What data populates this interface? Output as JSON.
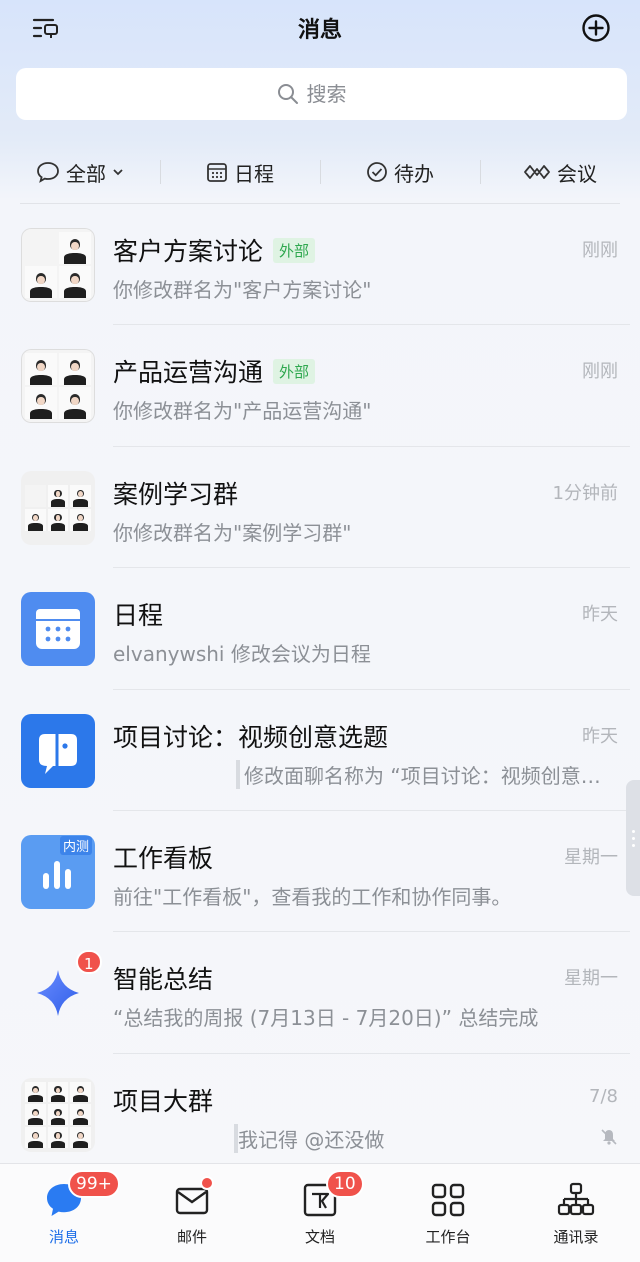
{
  "header": {
    "title": "消息"
  },
  "search": {
    "placeholder": "搜索"
  },
  "filters": [
    {
      "label": "全部"
    },
    {
      "label": "日程"
    },
    {
      "label": "待办"
    },
    {
      "label": "会议"
    }
  ],
  "conversations": [
    {
      "name": "客户方案讨论",
      "tag": "外部",
      "time": "刚刚",
      "preview": "你修改群名为\"客户方案讨论\""
    },
    {
      "name": "产品运营沟通",
      "tag": "外部",
      "time": "刚刚",
      "preview": "你修改群名为\"产品运营沟通\""
    },
    {
      "name": "案例学习群",
      "time": "1分钟前",
      "preview": "你修改群名为\"案例学习群\""
    },
    {
      "name": "日程",
      "time": "昨天",
      "preview": "elvanywshi 修改会议为日程"
    },
    {
      "name": "项目讨论：视频创意选题",
      "time": "昨天",
      "preview": "修改面聊名称为 “项目讨论：视频创意选题”"
    },
    {
      "name": "工作看板",
      "time": "星期一",
      "preview": "前往\"工作看板\"，查看我的工作和协作同事。",
      "avatar_tag": "内测"
    },
    {
      "name": "智能总结",
      "time": "星期一",
      "preview": "“总结我的周报 (7月13日 - 7月20日)” 总结完成",
      "badge": "1"
    },
    {
      "name": "项目大群",
      "time": "7/8",
      "preview": "我记得 @还没做"
    }
  ],
  "tabs": [
    {
      "label": "消息",
      "badge": "99+"
    },
    {
      "label": "邮件"
    },
    {
      "label": "文档",
      "badge": "10"
    },
    {
      "label": "工作台"
    },
    {
      "label": "通讯录"
    }
  ],
  "colors": {
    "accent": "#1f6fe8",
    "badge": "#f0524b",
    "tag_text": "#2fa84f",
    "tag_bg": "#dff3e3"
  }
}
